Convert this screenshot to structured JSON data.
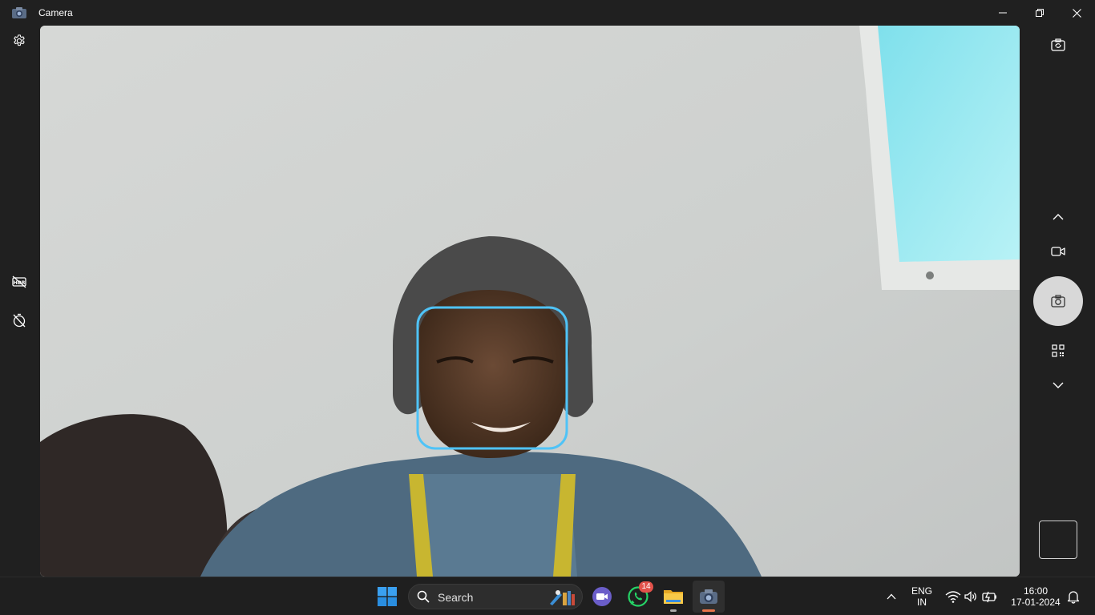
{
  "window": {
    "title": "Camera"
  },
  "taskbar": {
    "search_label": "Search",
    "whatsapp_badge": "14",
    "language": {
      "line1": "ENG",
      "line2": "IN"
    },
    "clock": {
      "time": "16:00",
      "date": "17-01-2024"
    }
  },
  "colors": {
    "face_box": "#4fc3f7",
    "badge": "#e2524a",
    "camera_indicator": "#e8754a"
  },
  "icons": {
    "left_rail": [
      "gear-icon",
      "hdr-off-icon",
      "timer-off-icon"
    ],
    "right_rail": [
      "switch-camera-icon",
      "chevron-up-icon",
      "video-mode-icon",
      "photo-shutter-icon",
      "qr-code-icon",
      "chevron-down-icon"
    ]
  }
}
